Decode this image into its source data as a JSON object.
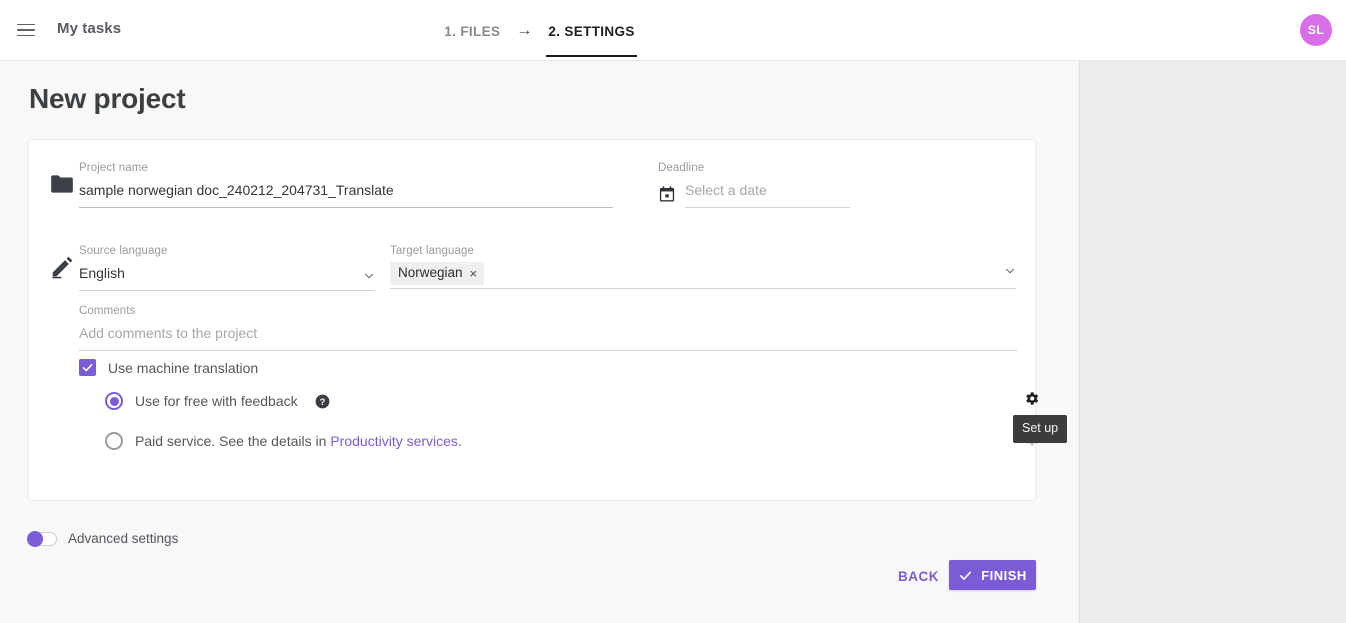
{
  "topbar": {
    "menu_icon": "hamburger-icon",
    "my_tasks_label": "My tasks",
    "steps": [
      {
        "label": "1. FILES",
        "active": false
      },
      {
        "label": "2. SETTINGS",
        "active": true
      }
    ],
    "step_arrow": "→",
    "avatar_initials": "SL",
    "avatar_color": "#d96fe8"
  },
  "page": {
    "title": "New project"
  },
  "form": {
    "folder_icon": "folder-icon",
    "pencil_icon": "pencil-icon",
    "project_name": {
      "label": "Project name",
      "value": "sample norwegian doc_240212_204731_Translate",
      "placeholder": "Project name"
    },
    "deadline": {
      "label": "Deadline",
      "value": "",
      "placeholder": "Select a date",
      "icon": "calendar-icon"
    },
    "source_language": {
      "label": "Source language",
      "value": "English",
      "icon": "chevron-down-icon"
    },
    "target_language": {
      "label": "Target language",
      "chips": [
        "Norwegian"
      ],
      "chip_remove": "×",
      "icon": "chevron-down-icon"
    },
    "comments": {
      "label": "Comments",
      "value": "",
      "placeholder": "Add comments to the project"
    },
    "machine_translation": {
      "label": "Use machine translation",
      "checked": true,
      "options": [
        {
          "label": "Use for free with feedback",
          "selected": true,
          "help_icon": "help-circle-icon",
          "gear_icon": "gear-icon",
          "gear_enabled": true
        },
        {
          "label_prefix": "Paid service. See the details in ",
          "link_text": "Productivity services",
          "label_suffix": ".",
          "selected": false,
          "gear_icon": "gear-icon",
          "gear_enabled": false
        }
      ]
    }
  },
  "tooltip": {
    "text": "Set up"
  },
  "advanced": {
    "label": "Advanced settings",
    "enabled": false
  },
  "footer": {
    "back_label": "BACK",
    "finish_label": "FINISH",
    "finish_icon": "check-icon"
  },
  "colors": {
    "accent": "#7c5cd6",
    "page_bg": "#f8f8f8",
    "panel_bg": "#ececec",
    "card_bg": "#ffffff",
    "tooltip_bg": "#3c3c3c"
  }
}
